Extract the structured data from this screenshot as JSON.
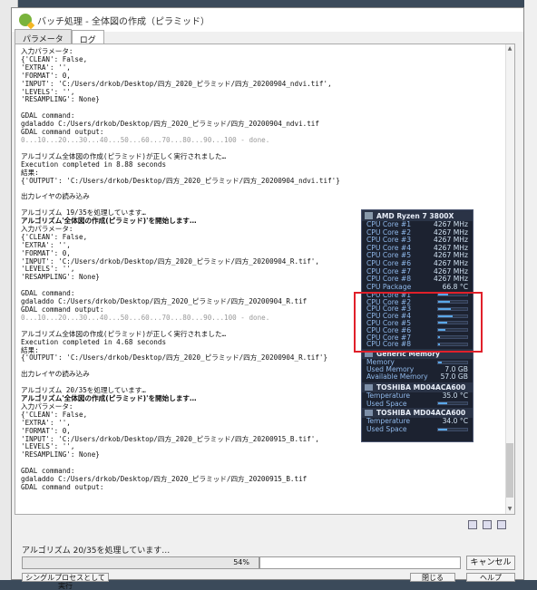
{
  "window": {
    "title": "バッチ処理 - 全体図の作成（ピラミッド）"
  },
  "tabs": [
    {
      "label": "パラメータ"
    },
    {
      "label": "ログ"
    }
  ],
  "log_lines": [
    "入力パラメータ:",
    "{'CLEAN': False,",
    "'EXTRA': '',",
    "'FORMAT': 0,",
    "'INPUT': 'C:/Users/drkob/Desktop/四方_2020_ピラミッド/四方_20200904_ndvi.tif',",
    "'LEVELS': '',",
    "'RESAMPLING': None}",
    "",
    "GDAL command:",
    "gdaladdo C:/Users/drkob/Desktop/四方_2020_ピラミッド/四方_20200904_ndvi.tif",
    "GDAL command output:",
    "0...10...20...30...40...50...60...70...80...90...100 - done.",
    "",
    "アルゴリズム全体図の作成(ピラミッド)が正しく実行されました…",
    "Execution completed in 8.88 seconds",
    "結果:",
    "{'OUTPUT': 'C:/Users/drkob/Desktop/四方_2020_ピラミッド/四方_20200904_ndvi.tif'}",
    "",
    "出力レイヤの読み込み",
    "",
    "アルゴリズム 19/35を処理しています…",
    "アルゴリズム'全体図の作成(ピラミッド)'を開始します…",
    "入力パラメータ:",
    "{'CLEAN': False,",
    "'EXTRA': '',",
    "'FORMAT': 0,",
    "'INPUT': 'C:/Users/drkob/Desktop/四方_2020_ピラミッド/四方_20200904_R.tif',",
    "'LEVELS': '',",
    "'RESAMPLING': None}",
    "",
    "GDAL command:",
    "gdaladdo C:/Users/drkob/Desktop/四方_2020_ピラミッド/四方_20200904_R.tif",
    "GDAL command output:",
    "0...10...20...30...40...50...60...70...80...90...100 - done.",
    "",
    "アルゴリズム全体図の作成(ピラミッド)が正しく実行されました…",
    "Execution completed in 4.68 seconds",
    "結果:",
    "{'OUTPUT': 'C:/Users/drkob/Desktop/四方_2020_ピラミッド/四方_20200904_R.tif'}",
    "",
    "出力レイヤの読み込み",
    "",
    "アルゴリズム 20/35を処理しています…",
    "アルゴリズム'全体図の作成(ピラミッド)'を開始します…",
    "入力パラメータ:",
    "{'CLEAN': False,",
    "'EXTRA': '',",
    "'FORMAT': 0,",
    "'INPUT': 'C:/Users/drkob/Desktop/四方_2020_ピラミッド/四方_20200915_B.tif',",
    "'LEVELS': '',",
    "'RESAMPLING': None}",
    "",
    "GDAL command:",
    "gdaladdo C:/Users/drkob/Desktop/四方_2020_ピラミッド/四方_20200915_B.tif",
    "GDAL command output:"
  ],
  "status": {
    "label": "アルゴリズム 20/35を処理しています…",
    "progress_percent": 54,
    "progress_text": "54%"
  },
  "buttons": {
    "cancel": "キャンセル",
    "run_batch": "シングルプロセスとして実行",
    "close": "閉じる",
    "help": "ヘルプ"
  },
  "gadget": {
    "cpu_title": "AMD Ryzen 7 3800X",
    "cores": [
      {
        "name": "CPU Core #1",
        "value": "4267 MHz"
      },
      {
        "name": "CPU Core #2",
        "value": "4267 MHz"
      },
      {
        "name": "CPU Core #3",
        "value": "4267 MHz"
      },
      {
        "name": "CPU Core #4",
        "value": "4267 MHz"
      },
      {
        "name": "CPU Core #5",
        "value": "4267 MHz"
      },
      {
        "name": "CPU Core #6",
        "value": "4267 MHz"
      },
      {
        "name": "CPU Core #7",
        "value": "4267 MHz"
      },
      {
        "name": "CPU Core #8",
        "value": "4267 MHz"
      }
    ],
    "package": {
      "name": "CPU Package",
      "value": "66.8 °C"
    },
    "loads": [
      {
        "name": "CPU Core #1",
        "level": 0.35
      },
      {
        "name": "CPU Core #2",
        "level": 0.4
      },
      {
        "name": "CPU Core #3",
        "level": 0.45
      },
      {
        "name": "CPU Core #4",
        "level": 0.5
      },
      {
        "name": "CPU Core #5",
        "level": 0.3
      },
      {
        "name": "CPU Core #6",
        "level": 0.25
      },
      {
        "name": "CPU Core #7",
        "level": 0.05
      },
      {
        "name": "CPU Core #8",
        "level": 0.05
      }
    ],
    "memory_title": "Generic Memory",
    "memory": [
      {
        "name": "Memory",
        "value": ""
      },
      {
        "name": "Used Memory",
        "value": "7.0 GB"
      },
      {
        "name": "Available Memory",
        "value": "57.0 GB"
      }
    ],
    "memory_level": 0.11,
    "disks": [
      {
        "title": "TOSHIBA MD04ACA600",
        "temp_label": "Temperature",
        "temp": "35.0 °C",
        "used_label": "Used Space",
        "used_level": 0.3
      },
      {
        "title": "TOSHIBA MD04ACA600",
        "temp_label": "Temperature",
        "temp": "34.0 °C",
        "used_label": "Used Space",
        "used_level": 0.3
      }
    ]
  }
}
